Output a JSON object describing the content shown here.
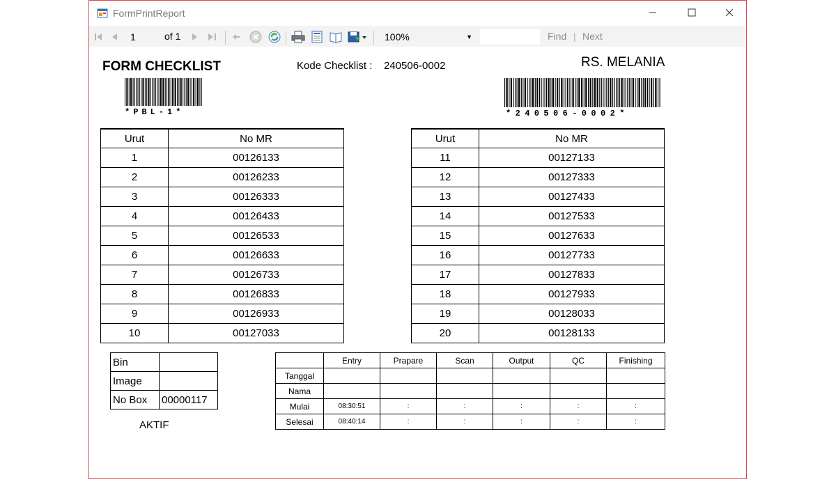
{
  "window": {
    "title": "FormPrintReport"
  },
  "toolbar": {
    "current_page": "1",
    "of_label": "of",
    "total_pages": "1",
    "zoom": "100%",
    "find_label": "Find",
    "separator": "|",
    "next_label": "Next",
    "find_value": ""
  },
  "report": {
    "heading": "FORM CHECKLIST",
    "kode_label": "Kode Checklist :",
    "kode_value": "240506-0002",
    "hospital": "RS. MELANIA",
    "barcode_left_text": "*PBL-1*",
    "barcode_right_text": "*240506-0002*",
    "table_headers": {
      "urut": "Urut",
      "no_mr": "No MR"
    },
    "left_rows": [
      {
        "urut": "1",
        "no_mr": "00126133"
      },
      {
        "urut": "2",
        "no_mr": "00126233"
      },
      {
        "urut": "3",
        "no_mr": "00126333"
      },
      {
        "urut": "4",
        "no_mr": "00126433"
      },
      {
        "urut": "5",
        "no_mr": "00126533"
      },
      {
        "urut": "6",
        "no_mr": "00126633"
      },
      {
        "urut": "7",
        "no_mr": "00126733"
      },
      {
        "urut": "8",
        "no_mr": "00126833"
      },
      {
        "urut": "9",
        "no_mr": "00126933"
      },
      {
        "urut": "10",
        "no_mr": "00127033"
      }
    ],
    "right_rows": [
      {
        "urut": "11",
        "no_mr": "00127133"
      },
      {
        "urut": "12",
        "no_mr": "00127333"
      },
      {
        "urut": "13",
        "no_mr": "00127433"
      },
      {
        "urut": "14",
        "no_mr": "00127533"
      },
      {
        "urut": "15",
        "no_mr": "00127633"
      },
      {
        "urut": "16",
        "no_mr": "00127733"
      },
      {
        "urut": "17",
        "no_mr": "00127833"
      },
      {
        "urut": "18",
        "no_mr": "00127933"
      },
      {
        "urut": "19",
        "no_mr": "00128033"
      },
      {
        "urut": "20",
        "no_mr": "00128133"
      }
    ],
    "info": [
      {
        "label": "Bin",
        "value": ""
      },
      {
        "label": "Image",
        "value": ""
      },
      {
        "label": "No Box",
        "value": "00000117"
      }
    ],
    "status_text": "AKTIF",
    "status_table": {
      "columns": [
        "Entry",
        "Prapare",
        "Scan",
        "Output",
        "QC",
        "Finishing"
      ],
      "rows": [
        {
          "label": "Tanggal",
          "cells": [
            "",
            "",
            "",
            "",
            "",
            ""
          ]
        },
        {
          "label": "Nama",
          "cells": [
            "",
            "",
            "",
            "",
            "",
            ""
          ]
        },
        {
          "label": "Mulai",
          "cells": [
            "08:30:51",
            ":",
            ":",
            ":",
            ":",
            ":"
          ]
        },
        {
          "label": "Selesai",
          "cells": [
            "08:40:14",
            ":",
            ":",
            ":",
            ":",
            ":"
          ]
        }
      ]
    }
  },
  "colors": {
    "window_border": "#e0474c",
    "toolbar_bg": "#f3f3f3"
  },
  "icons": [
    "app-icon",
    "minimize-icon",
    "maximize-icon",
    "close-icon",
    "first-page-icon",
    "prev-page-icon",
    "next-page-icon",
    "last-page-icon",
    "back-icon",
    "stop-icon",
    "refresh-icon",
    "print-icon",
    "print-layout-icon",
    "page-setup-icon",
    "export-icon",
    "zoom-dropdown-icon"
  ]
}
